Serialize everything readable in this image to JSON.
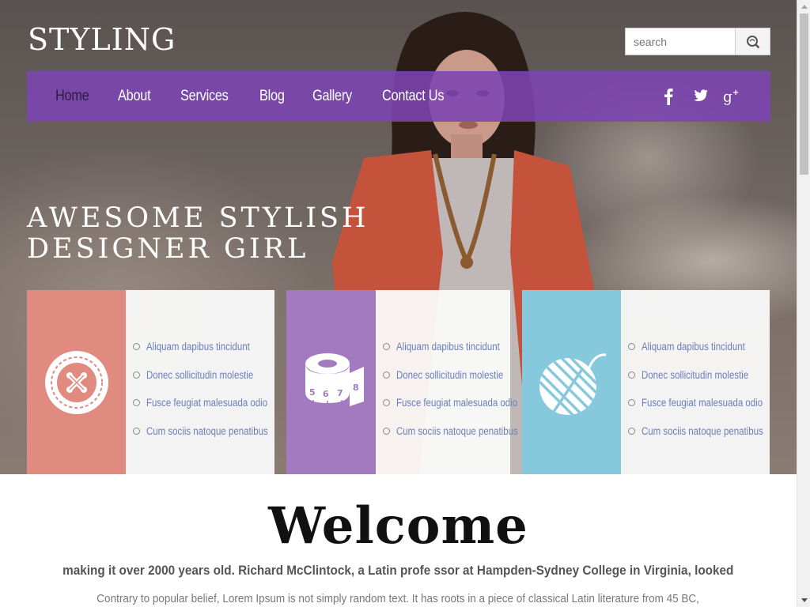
{
  "site": {
    "logo": "STYLING"
  },
  "search": {
    "placeholder": "search"
  },
  "nav": {
    "items": [
      {
        "label": "Home",
        "active": true
      },
      {
        "label": "About",
        "active": false
      },
      {
        "label": "Services",
        "active": false
      },
      {
        "label": "Blog",
        "active": false
      },
      {
        "label": "Gallery",
        "active": false
      },
      {
        "label": "Contact Us",
        "active": false
      }
    ],
    "social": [
      "facebook-icon",
      "twitter-icon",
      "google-plus-icon"
    ]
  },
  "hero": {
    "tagline_line1": "AWESOME STYLISH",
    "tagline_line2": "DESIGNER GIRL"
  },
  "cards": [
    {
      "icon": "button-icon",
      "color": "#e08a80",
      "items": [
        "Aliquam dapibus tincidunt",
        "Donec sollicitudin molestie",
        "Fusce feugiat malesuada odio",
        "Cum sociis natoque penatibus"
      ]
    },
    {
      "icon": "measuring-tape-icon",
      "color": "#a37ac0",
      "tape_numbers": [
        "5",
        "6",
        "7",
        "8"
      ],
      "items": [
        "Aliquam dapibus tincidunt",
        "Donec sollicitudin molestie",
        "Fusce feugiat malesuada odio",
        "Cum sociis natoque penatibus"
      ]
    },
    {
      "icon": "yarn-ball-icon",
      "color": "#86c9dd",
      "items": [
        "Aliquam dapibus tincidunt",
        "Donec sollicitudin molestie",
        "Fusce feugiat malesuada odio",
        "Cum sociis natoque penatibus"
      ]
    }
  ],
  "welcome": {
    "title": "Welcome",
    "bold_text": "making it over 2000 years old. Richard McClintock, a Latin profe ssor at Hampden-Sydney College in Virginia, looked",
    "body_text": "Contrary to popular belief, Lorem Ipsum is not simply random text. It has roots in a piece of classical Latin literature from 45 BC,"
  },
  "colors": {
    "nav_bg": "#7c44b2",
    "card1": "#e08a80",
    "card2": "#a37ac0",
    "card3": "#86c9dd",
    "link_text": "#6b7fb8"
  }
}
